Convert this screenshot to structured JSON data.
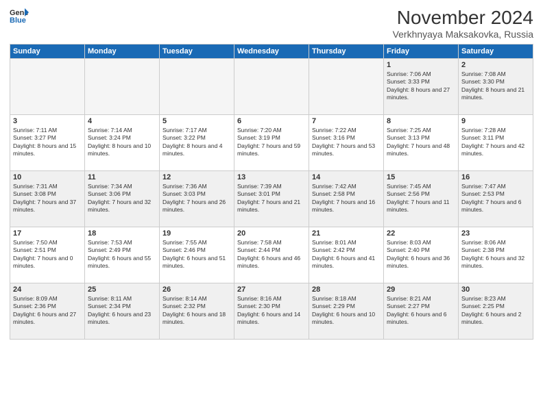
{
  "header": {
    "logo_line1": "General",
    "logo_line2": "Blue",
    "month_title": "November 2024",
    "location": "Verkhnyaya Maksakovka, Russia"
  },
  "weekdays": [
    "Sunday",
    "Monday",
    "Tuesday",
    "Wednesday",
    "Thursday",
    "Friday",
    "Saturday"
  ],
  "weeks": [
    [
      {
        "day": "",
        "info": ""
      },
      {
        "day": "",
        "info": ""
      },
      {
        "day": "",
        "info": ""
      },
      {
        "day": "",
        "info": ""
      },
      {
        "day": "",
        "info": ""
      },
      {
        "day": "1",
        "info": "Sunrise: 7:06 AM\nSunset: 3:33 PM\nDaylight: 8 hours and 27 minutes."
      },
      {
        "day": "2",
        "info": "Sunrise: 7:08 AM\nSunset: 3:30 PM\nDaylight: 8 hours and 21 minutes."
      }
    ],
    [
      {
        "day": "3",
        "info": "Sunrise: 7:11 AM\nSunset: 3:27 PM\nDaylight: 8 hours and 15 minutes."
      },
      {
        "day": "4",
        "info": "Sunrise: 7:14 AM\nSunset: 3:24 PM\nDaylight: 8 hours and 10 minutes."
      },
      {
        "day": "5",
        "info": "Sunrise: 7:17 AM\nSunset: 3:22 PM\nDaylight: 8 hours and 4 minutes."
      },
      {
        "day": "6",
        "info": "Sunrise: 7:20 AM\nSunset: 3:19 PM\nDaylight: 7 hours and 59 minutes."
      },
      {
        "day": "7",
        "info": "Sunrise: 7:22 AM\nSunset: 3:16 PM\nDaylight: 7 hours and 53 minutes."
      },
      {
        "day": "8",
        "info": "Sunrise: 7:25 AM\nSunset: 3:13 PM\nDaylight: 7 hours and 48 minutes."
      },
      {
        "day": "9",
        "info": "Sunrise: 7:28 AM\nSunset: 3:11 PM\nDaylight: 7 hours and 42 minutes."
      }
    ],
    [
      {
        "day": "10",
        "info": "Sunrise: 7:31 AM\nSunset: 3:08 PM\nDaylight: 7 hours and 37 minutes."
      },
      {
        "day": "11",
        "info": "Sunrise: 7:34 AM\nSunset: 3:06 PM\nDaylight: 7 hours and 32 minutes."
      },
      {
        "day": "12",
        "info": "Sunrise: 7:36 AM\nSunset: 3:03 PM\nDaylight: 7 hours and 26 minutes."
      },
      {
        "day": "13",
        "info": "Sunrise: 7:39 AM\nSunset: 3:01 PM\nDaylight: 7 hours and 21 minutes."
      },
      {
        "day": "14",
        "info": "Sunrise: 7:42 AM\nSunset: 2:58 PM\nDaylight: 7 hours and 16 minutes."
      },
      {
        "day": "15",
        "info": "Sunrise: 7:45 AM\nSunset: 2:56 PM\nDaylight: 7 hours and 11 minutes."
      },
      {
        "day": "16",
        "info": "Sunrise: 7:47 AM\nSunset: 2:53 PM\nDaylight: 7 hours and 6 minutes."
      }
    ],
    [
      {
        "day": "17",
        "info": "Sunrise: 7:50 AM\nSunset: 2:51 PM\nDaylight: 7 hours and 0 minutes."
      },
      {
        "day": "18",
        "info": "Sunrise: 7:53 AM\nSunset: 2:49 PM\nDaylight: 6 hours and 55 minutes."
      },
      {
        "day": "19",
        "info": "Sunrise: 7:55 AM\nSunset: 2:46 PM\nDaylight: 6 hours and 51 minutes."
      },
      {
        "day": "20",
        "info": "Sunrise: 7:58 AM\nSunset: 2:44 PM\nDaylight: 6 hours and 46 minutes."
      },
      {
        "day": "21",
        "info": "Sunrise: 8:01 AM\nSunset: 2:42 PM\nDaylight: 6 hours and 41 minutes."
      },
      {
        "day": "22",
        "info": "Sunrise: 8:03 AM\nSunset: 2:40 PM\nDaylight: 6 hours and 36 minutes."
      },
      {
        "day": "23",
        "info": "Sunrise: 8:06 AM\nSunset: 2:38 PM\nDaylight: 6 hours and 32 minutes."
      }
    ],
    [
      {
        "day": "24",
        "info": "Sunrise: 8:09 AM\nSunset: 2:36 PM\nDaylight: 6 hours and 27 minutes."
      },
      {
        "day": "25",
        "info": "Sunrise: 8:11 AM\nSunset: 2:34 PM\nDaylight: 6 hours and 23 minutes."
      },
      {
        "day": "26",
        "info": "Sunrise: 8:14 AM\nSunset: 2:32 PM\nDaylight: 6 hours and 18 minutes."
      },
      {
        "day": "27",
        "info": "Sunrise: 8:16 AM\nSunset: 2:30 PM\nDaylight: 6 hours and 14 minutes."
      },
      {
        "day": "28",
        "info": "Sunrise: 8:18 AM\nSunset: 2:29 PM\nDaylight: 6 hours and 10 minutes."
      },
      {
        "day": "29",
        "info": "Sunrise: 8:21 AM\nSunset: 2:27 PM\nDaylight: 6 hours and 6 minutes."
      },
      {
        "day": "30",
        "info": "Sunrise: 8:23 AM\nSunset: 2:25 PM\nDaylight: 6 hours and 2 minutes."
      }
    ]
  ]
}
